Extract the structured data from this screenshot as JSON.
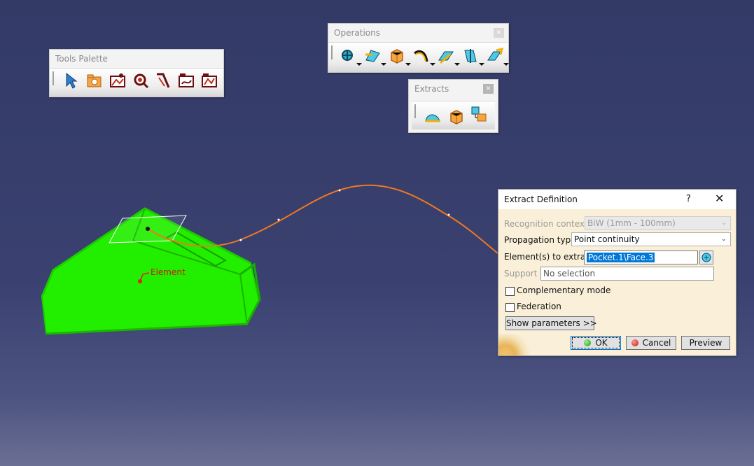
{
  "tools_palette": {
    "title": "Tools Palette",
    "icons": [
      "select-mode-icon",
      "open-folder-icon",
      "extract-image-icon",
      "search-icon",
      "bend-arrow-icon",
      "axis-system-icon",
      "curve-feature-icon"
    ]
  },
  "operations": {
    "title": "Operations",
    "close": "×",
    "icons": [
      "join-icon",
      "healing-icon",
      "extract-icon",
      "fillet-icon",
      "translate-icon",
      "split-icon",
      "extrapolate-icon"
    ]
  },
  "extracts": {
    "title": "Extracts",
    "close": "×",
    "icons": [
      "boundary-icon",
      "extract-icon",
      "multiple-extract-icon"
    ]
  },
  "viewport": {
    "element_label": "Element",
    "curve_color": "#f07820",
    "part_color": "#22ee00"
  },
  "dialog": {
    "title": "Extract Definition",
    "help": "?",
    "close": "✕",
    "recognition_label": "Recognition context:",
    "recognition_value": "BiW (1mm - 100mm)",
    "propagation_label": "Propagation type:",
    "propagation_value": "Point continuity",
    "elements_label": "Element(s) to extract",
    "elements_value": "Pocket.1\\Face.3",
    "support_label": "Support :",
    "support_value": "No selection",
    "complementary_label": "Complementary mode",
    "federation_label": "Federation",
    "show_params": "Show parameters >>",
    "ok": "OK",
    "cancel": "Cancel",
    "preview": "Preview"
  }
}
